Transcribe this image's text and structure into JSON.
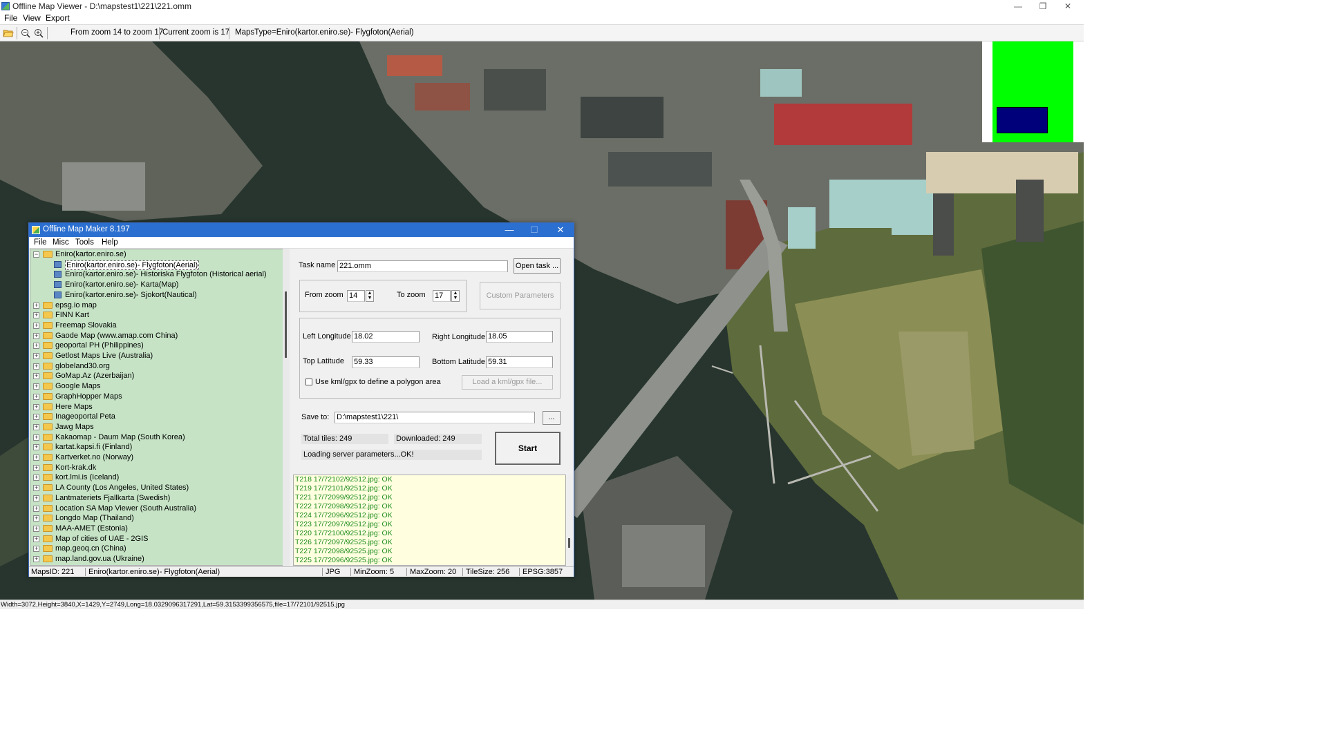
{
  "window": {
    "title": "Offline Map Viewer - D:\\mapstest1\\221\\221.omm",
    "controls": {
      "minimize": "—",
      "restore": "❐",
      "close": "✕"
    }
  },
  "menu": [
    "File",
    "View",
    "Export"
  ],
  "toolbar": {
    "open_icon": "folder-open-icon",
    "zoom_out_icon": "zoom-out-icon",
    "zoom_in_icon": "zoom-in-icon",
    "zoom_range": "From zoom 14 to zoom 17",
    "current_zoom": "Current zoom is 17",
    "maps_type": "MapsType=Eniro(kartor.eniro.se)- Flygfoton(Aerial)"
  },
  "status_line": "Width=3072,Height=3840,X=1429,Y=2749,Long=18.0329096317291,Lat=59.3153399356575,file=17/72101/92515.jpg",
  "dialog": {
    "title": "Offline Map Maker 8.197",
    "controls": {
      "minimize": "—",
      "maximize": "☐",
      "close": "✕"
    },
    "menu": [
      "File",
      "Misc",
      "Tools",
      "Help"
    ],
    "tree": {
      "root": "Eniro(kartor.eniro.se)",
      "children": [
        "Eniro(kartor.eniro.se)- Flygfoton(Aerial)",
        "Eniro(kartor.eniro.se)- Historiska Flygfoton (Historical aerial)",
        "Eniro(kartor.eniro.se)- Karta(Map)",
        "Eniro(kartor.eniro.se)- Sjokort(Nautical)"
      ],
      "folders": [
        "epsg.io map",
        "FINN Kart",
        "Freemap Slovakia",
        "Gaode Map (www.amap.com China)",
        "geoportal PH (Philippines)",
        "Getlost Maps Live (Australia)",
        "globeland30.org",
        "GoMap.Az (Azerbaijan)",
        "Google Maps",
        "GraphHopper Maps",
        "Here Maps",
        "Inageoportal Peta",
        "Jawg Maps",
        "Kakaomap - Daum Map (South Korea)",
        "kartat.kapsi.fi (Finland)",
        "Kartverket.no (Norway)",
        "Kort-krak.dk",
        "kort.lmi.is (Iceland)",
        "LA County (Los Angeles, United States)",
        "Lantmateriets Fjallkarta (Swedish)",
        "Location SA Map Viewer (South Australia)",
        "Longdo Map (Thailand)",
        "MAA-AMET (Estonia)",
        "Map of cities of UAE - 2GIS",
        "map.geoq.cn (China)",
        "map.land.gov.ua (Ukraine)"
      ]
    },
    "form": {
      "task_name_label": "Task name",
      "task_name_value": "221.omm",
      "open_task_btn": "Open task ...",
      "from_zoom_label": "From zoom",
      "from_zoom_value": "14",
      "to_zoom_label": "To zoom",
      "to_zoom_value": "17",
      "custom_params_btn": "Custom Parameters",
      "left_lon_label": "Left Longitude",
      "left_lon_value": "18.02",
      "right_lon_label": "Right Longitude",
      "right_lon_value": "18.05",
      "top_lat_label": "Top Latitude",
      "top_lat_value": "59.33",
      "bottom_lat_label": "Bottom Latitude",
      "bottom_lat_value": "59.31",
      "kml_label": "Use kml/gpx to define a polygon area",
      "kml_checked": false,
      "load_kml_btn": "Load a kml/gpx file...",
      "save_to_label": "Save to:",
      "save_to_value": "D:\\mapstest1\\221\\",
      "browse_btn": "...",
      "total_tiles": "Total tiles: 249",
      "downloaded": "Downloaded: 249",
      "status": "Loading server parameters...OK!",
      "start_btn": "Start"
    },
    "log": [
      "T218 17/72102/92512.jpg: OK",
      "T219 17/72101/92512.jpg: OK",
      "T221 17/72099/92512.jpg: OK",
      "T222 17/72098/92512.jpg: OK",
      "T224 17/72096/92512.jpg: OK",
      "T223 17/72097/92512.jpg: OK",
      "T220 17/72100/92512.jpg: OK",
      "T226 17/72097/92525.jpg: OK",
      "T227 17/72098/92525.jpg: OK",
      "T225 17/72096/92525.jpg: OK"
    ],
    "statusbar": {
      "maps_id": "MapsID: 221",
      "maps_name": "Eniro(kartor.eniro.se)- Flygfoton(Aerial)",
      "format": "JPG",
      "min_zoom": "MinZoom: 5",
      "max_zoom": "MaxZoom: 20",
      "tile_size": "TileSize: 256",
      "epsg": "EPSG:3857"
    }
  },
  "colors": {
    "tree_bg": "#c6e3c6",
    "log_bg": "#ffffe0",
    "log_text": "#1a8a1a",
    "dialog_title": "#2b6fd0",
    "minimap_green": "#00ff00",
    "minimap_blue": "#00007a"
  }
}
